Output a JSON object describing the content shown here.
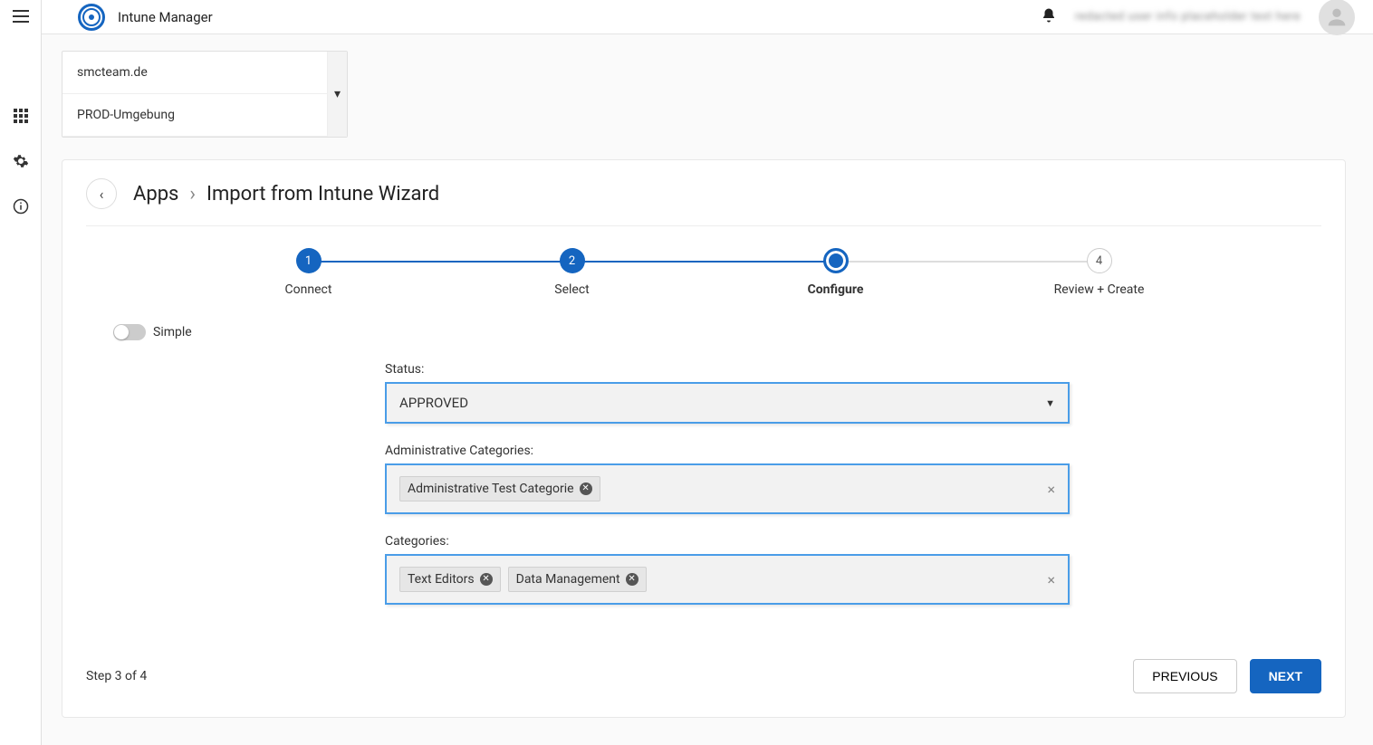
{
  "app_title": "Intune Manager",
  "user_display": "redacted user info placeholder text here",
  "env": {
    "tenant": "smcteam.de",
    "environment": "PROD-Umgebung"
  },
  "breadcrumb": {
    "root": "Apps",
    "current": "Import from Intune Wizard"
  },
  "stepper": {
    "steps": [
      {
        "num": "1",
        "label": "Connect",
        "state": "done"
      },
      {
        "num": "2",
        "label": "Select",
        "state": "done"
      },
      {
        "num": "3",
        "label": "Configure",
        "state": "current"
      },
      {
        "num": "4",
        "label": "Review + Create",
        "state": "future"
      }
    ]
  },
  "toggle": {
    "label": "Simple"
  },
  "form": {
    "status_label": "Status:",
    "status_value": "APPROVED",
    "admin_cat_label": "Administrative Categories:",
    "admin_cat_chips": [
      "Administrative Test Categorie"
    ],
    "cat_label": "Categories:",
    "cat_chips": [
      "Text Editors",
      "Data Management"
    ]
  },
  "footer": {
    "step_text": "Step 3 of 4",
    "previous": "PREVIOUS",
    "next": "NEXT"
  }
}
